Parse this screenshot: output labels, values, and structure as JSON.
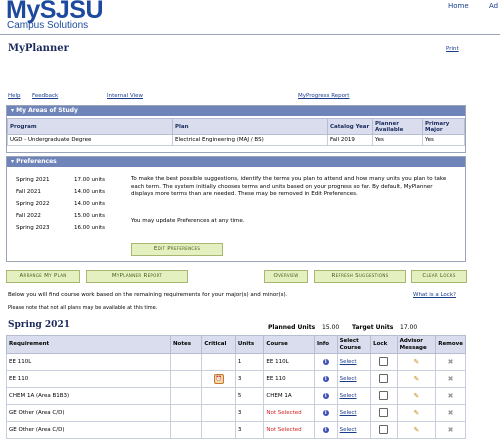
{
  "header": {
    "logo_main": "MySJSU",
    "logo_sub": "Campus Solutions",
    "top_links": [
      "Home",
      "Ad"
    ]
  },
  "page_title": "MyPlanner",
  "print_link": "Print",
  "nav_links": {
    "help": "Help",
    "feedback": "Feedback",
    "internal_view": "Internal View",
    "progress_report": "MyProgress Report"
  },
  "areas_of_study": {
    "title": "My Areas of Study",
    "columns": [
      "Program",
      "Plan",
      "Catalog Year",
      "Planner Available",
      "Primary Major"
    ],
    "rows": [
      [
        "UGD - Undergraduate Degree",
        "Electrical Engineering (MAJ / BS)",
        "Fall 2019",
        "Yes",
        "Yes"
      ]
    ]
  },
  "preferences": {
    "title": "Preferences",
    "terms": [
      {
        "term": "Spring 2021",
        "units": "17.00 units"
      },
      {
        "term": "Fall 2021",
        "units": "14.00 units"
      },
      {
        "term": "Spring 2022",
        "units": "14.00 units"
      },
      {
        "term": "Fall 2022",
        "units": "15.00 units"
      },
      {
        "term": "Spring 2023",
        "units": "16.00 units"
      }
    ],
    "description_1": "To make the best possible suggestions, identify the terms you plan to attend and how many units you plan to take each term. The system initially chooses terms and units based on your progress so far. By default, MyPlanner displays more terms than are needed. These may be removed in Edit Preferences.",
    "description_2": "You may update Preferences at any time.",
    "edit_button": "Edit Preferences"
  },
  "action_buttons": {
    "arrange": "Arrange My Plan",
    "report": "MyPlanner Report",
    "overview": "Overview",
    "refresh": "Refresh Suggestions",
    "clear": "Clear Locks"
  },
  "info_text_1": "Below you will find course work based on the remaining requirements for your major(s) and minor(s).",
  "info_text_2": "Please note that not all plans may be available at this time.",
  "what_is_lock": "What is a Lock?",
  "term_plan": {
    "term": "Spring 2021",
    "planned_units_label": "Planned Units",
    "planned_units": "15.00",
    "target_units_label": "Target Units",
    "target_units": "17.00",
    "columns": [
      "Requirement",
      "Notes",
      "Critical",
      "Units",
      "Course",
      "Info",
      "Select Course",
      "Lock",
      "Advisor Message",
      "Remove"
    ],
    "rows": [
      {
        "requirement": "EE 110L",
        "units": "1",
        "course": "EE 110L",
        "critical": false,
        "not_selected": false,
        "select": "Select"
      },
      {
        "requirement": "EE 110",
        "units": "3",
        "course": "EE 110",
        "critical": true,
        "not_selected": false,
        "select": "Select"
      },
      {
        "requirement": "CHEM 1A (Area B1B3)",
        "units": "5",
        "course": "CHEM 1A",
        "critical": false,
        "not_selected": false,
        "select": "Select"
      },
      {
        "requirement": "GE Other (Area C/D)",
        "units": "3",
        "course": "Not Selected",
        "critical": false,
        "not_selected": true,
        "select": "Select"
      },
      {
        "requirement": "GE Other (Area C/D)",
        "units": "3",
        "course": "Not Selected",
        "critical": false,
        "not_selected": true,
        "select": "Select"
      }
    ]
  },
  "icons": {
    "info": "info-icon",
    "pencil": "pencil-icon",
    "remove": "remove-x-icon",
    "critical": "alarm-clock-icon"
  },
  "colors": {
    "brand": "#1d4a9e",
    "section_bar": "#6f84b8",
    "button_bg": "#e5f0c0",
    "not_selected": "#d62020"
  }
}
